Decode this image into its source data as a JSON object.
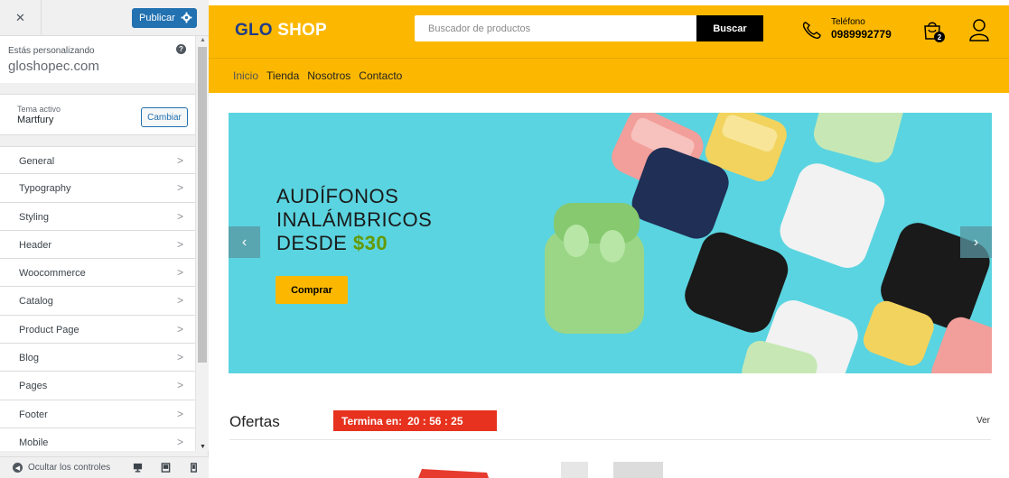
{
  "customizer": {
    "close_label": "✕",
    "publish_label": "Publicar",
    "editing_label": "Estás personalizando",
    "site_name": "gloshopec.com",
    "help_label": "?",
    "active_theme_label": "Tema activo",
    "active_theme_name": "Martfury",
    "change_label": "Cambiar",
    "sections": [
      {
        "label": "General"
      },
      {
        "label": "Typography"
      },
      {
        "label": "Styling"
      },
      {
        "label": "Header"
      },
      {
        "label": "Woocommerce"
      },
      {
        "label": "Catalog"
      },
      {
        "label": "Product Page"
      },
      {
        "label": "Blog"
      },
      {
        "label": "Pages"
      },
      {
        "label": "Footer"
      },
      {
        "label": "Mobile"
      }
    ],
    "hide_controls_label": "Ocultar los controles",
    "devices": [
      "desktop-icon",
      "tablet-icon",
      "mobile-icon"
    ]
  },
  "site": {
    "logo_part1": "GLO",
    "logo_part2": "SHOP",
    "search_placeholder": "Buscador de productos",
    "search_button": "Buscar",
    "phone_label": "Teléfono",
    "phone_number": "0989992779",
    "cart_count": "2",
    "nav": [
      {
        "label": "Inicio"
      },
      {
        "label": "Tienda"
      },
      {
        "label": "Nosotros"
      },
      {
        "label": "Contacto"
      }
    ],
    "banner": {
      "line1": "AUDÍFONOS",
      "line2": "INALÁMBRICOS",
      "line3_prefix": "DESDE",
      "price": "$30",
      "button": "Comprar",
      "prev": "‹",
      "next": "›"
    },
    "offers": {
      "title": "Ofertas",
      "ends_label": "Termina en:",
      "countdown": "20 : 56 : 25",
      "see_all": "Ver"
    }
  },
  "colors": {
    "brand_yellow": "#fcb800",
    "logo_blue": "#1f3c88",
    "wp_blue": "#2271b1",
    "banner_bg": "#5ad4e0",
    "countdown_red": "#e6321e",
    "price_green": "#669900"
  }
}
